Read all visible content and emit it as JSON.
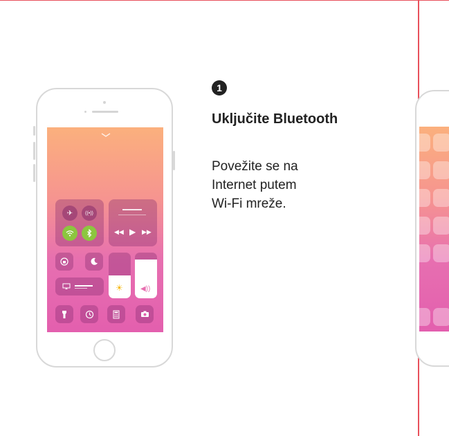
{
  "step": {
    "number": "1",
    "title": "Uključite Bluetooth",
    "description_lines": [
      "Povežite se na",
      "Internet putem",
      "Wi-Fi mreže."
    ]
  },
  "control_center": {
    "connectivity_active": [
      "wifi",
      "bluetooth"
    ],
    "connectivity_icons": [
      "airplane-icon",
      "cellular-icon",
      "wifi-icon",
      "bluetooth-icon"
    ],
    "brightness_level": 0.5,
    "volume_level": 0.85,
    "colors": {
      "active_toggle": "#8cc63f",
      "gradient_top": "#fbb07d",
      "gradient_bottom": "#e35fae",
      "accent_rule": "#e8505b"
    }
  }
}
